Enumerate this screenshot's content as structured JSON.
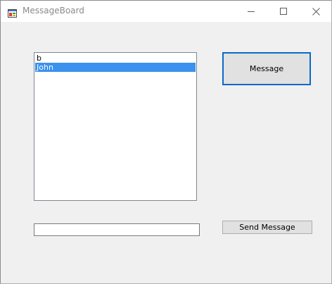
{
  "window": {
    "title": "MessageBoard",
    "app_icon": "app-form-icon",
    "controls": {
      "minimize_icon": "minimize-icon",
      "maximize_icon": "maximize-icon",
      "close_icon": "close-icon"
    }
  },
  "listbox": {
    "items": [
      {
        "label": "b",
        "selected": false
      },
      {
        "label": "John",
        "selected": true
      }
    ],
    "selection_color": "#3b91ee"
  },
  "message_button": {
    "label": "Message",
    "focus_border_color": "#0a69c9"
  },
  "message_input": {
    "value": ""
  },
  "send_button": {
    "label": "Send Message"
  }
}
